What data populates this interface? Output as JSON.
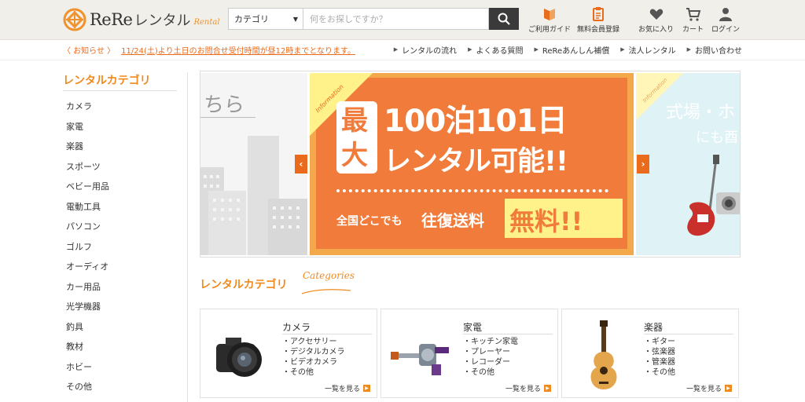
{
  "header": {
    "logo_text": "ReRe",
    "logo_jp": "レンタル",
    "logo_script": "Rental",
    "search": {
      "category_label": "カテゴリ",
      "placeholder": "何をお探しですか？"
    },
    "nav": {
      "guide": "ご利用ガイド",
      "register": "無料会員登録",
      "favorites": "お気に入り",
      "cart": "カート",
      "login": "ログイン"
    }
  },
  "notice": {
    "label": "〈 お知らせ 〉",
    "text": "11/24(土)より土日のお問合せ受付時間が昼12時までとなります。"
  },
  "topnav": [
    "レンタルの流れ",
    "よくある質問",
    "ReReあんしん補償",
    "法人レンタル",
    "お問い合わせ"
  ],
  "sidebar": {
    "title": "レンタルカテゴリ",
    "items": [
      "カメラ",
      "家電",
      "楽器",
      "スポーツ",
      "ベビー用品",
      "電動工具",
      "パソコン",
      "ゴルフ",
      "オーディオ",
      "カー用品",
      "光学機器",
      "釣具",
      "教材",
      "ホビー",
      "その他"
    ]
  },
  "carousel": {
    "left_partial_text": "ちら",
    "main": {
      "corner_tag": "Information",
      "badge_top": "最",
      "badge_bottom": "大",
      "line1": "100泊101日",
      "line2": "レンタル可能!!",
      "bottom_prefix": "全国どこでも",
      "bottom_middle": "往復送料",
      "bottom_highlight": "無料!!"
    },
    "right_partial": {
      "corner_tag": "Information",
      "line1": "式場・ホ",
      "line2": "にも酉"
    },
    "prev_label": "‹",
    "next_label": "›"
  },
  "section": {
    "title": "レンタルカテゴリ",
    "script": "Categories"
  },
  "cards": [
    {
      "name": "カメラ",
      "items": [
        "・アクセサリー",
        "・デジタルカメラ",
        "・ビデオカメラ",
        "・その他"
      ],
      "more": "一覧を見る"
    },
    {
      "name": "家電",
      "items": [
        "・キッチン家電",
        "・プレーヤー",
        "・レコーダー",
        "・その他"
      ],
      "more": "一覧を見る"
    },
    {
      "name": "楽器",
      "items": [
        "・ギター",
        "・弦楽器",
        "・管楽器",
        "・その他"
      ],
      "more": "一覧を見る"
    }
  ],
  "colors": {
    "accent": "#f08a1d",
    "notice": "#e96b1c",
    "banner": "#f4a84c",
    "header_bg": "#f0efea"
  }
}
